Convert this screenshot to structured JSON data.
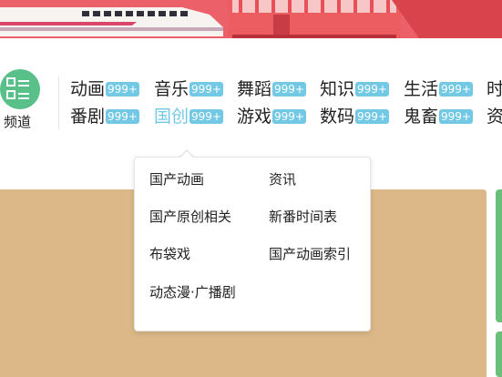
{
  "channel": {
    "label": "频道",
    "icon": "grid-list-icon",
    "accent": "#5ac08a"
  },
  "nav": {
    "row1": [
      {
        "label": "动画",
        "badge": "999+"
      },
      {
        "label": "音乐",
        "badge": "999+"
      },
      {
        "label": "舞蹈",
        "badge": "999+"
      },
      {
        "label": "知识",
        "badge": "999+"
      },
      {
        "label": "生活",
        "badge": "999+"
      },
      {
        "label": "时"
      }
    ],
    "row2": [
      {
        "label": "番剧",
        "badge": "999+"
      },
      {
        "label": "国创",
        "badge": "999+",
        "active": true
      },
      {
        "label": "游戏",
        "badge": "999+"
      },
      {
        "label": "数码",
        "badge": "999+"
      },
      {
        "label": "鬼畜",
        "badge": "999+"
      },
      {
        "label": "资"
      }
    ],
    "badge_color": "#73c9e5",
    "active_color": "#73c9e5"
  },
  "dropdown": {
    "items": [
      {
        "label": "国产动画"
      },
      {
        "label": "资讯"
      },
      {
        "label": "国产原创相关"
      },
      {
        "label": "新番时间表"
      },
      {
        "label": "布袋戏"
      },
      {
        "label": "国产动画索引"
      },
      {
        "label": "动态漫·广播剧"
      }
    ]
  },
  "colors": {
    "banner": "#e8484f",
    "content": "#dcb888",
    "card": "#6ac07a"
  }
}
